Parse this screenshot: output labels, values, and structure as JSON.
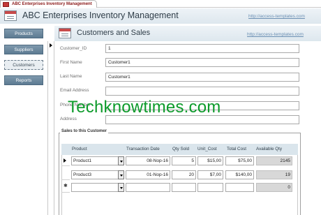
{
  "window": {
    "tab_title": "ABC Enterprises Inventory Management"
  },
  "header": {
    "title": "ABC Enterprises Inventory Management",
    "url": "http://access-templates.com"
  },
  "nav": [
    {
      "label": "Products"
    },
    {
      "label": "Suppliers"
    },
    {
      "label": "Customers"
    },
    {
      "label": "Reports"
    }
  ],
  "form": {
    "title": "Customers and Sales",
    "url": "http://access-templates.com",
    "fields": {
      "customer_id": {
        "label": "Customer_ID",
        "value": "1"
      },
      "first_name": {
        "label": "First Name",
        "value": "Customer1"
      },
      "last_name": {
        "label": "Last Name",
        "value": "Customer1"
      },
      "email": {
        "label": "Email Address",
        "value": ""
      },
      "phone": {
        "label": "Phone Number",
        "value": ""
      },
      "address": {
        "label": "Address",
        "value": ""
      }
    }
  },
  "watermark": "Techknowtimes.com",
  "subform": {
    "title": "Sales to this Customer",
    "columns": [
      "Product",
      "Transaction Date",
      "Qty Sold",
      "Unit_Cost",
      "Total Cost",
      "Available Qty"
    ],
    "rows": [
      {
        "product": "Product1",
        "date": "08-Nop-16",
        "qty": "5",
        "unit_cost": "$15,00",
        "total_cost": "$75,00",
        "available": "2145"
      },
      {
        "product": "Product3",
        "date": "01-Nop-16",
        "qty": "20",
        "unit_cost": "$7,00",
        "total_cost": "$140,00",
        "available": "19"
      },
      {
        "product": "",
        "date": "",
        "qty": "",
        "unit_cost": "",
        "total_cost": "",
        "available": "0"
      }
    ]
  }
}
